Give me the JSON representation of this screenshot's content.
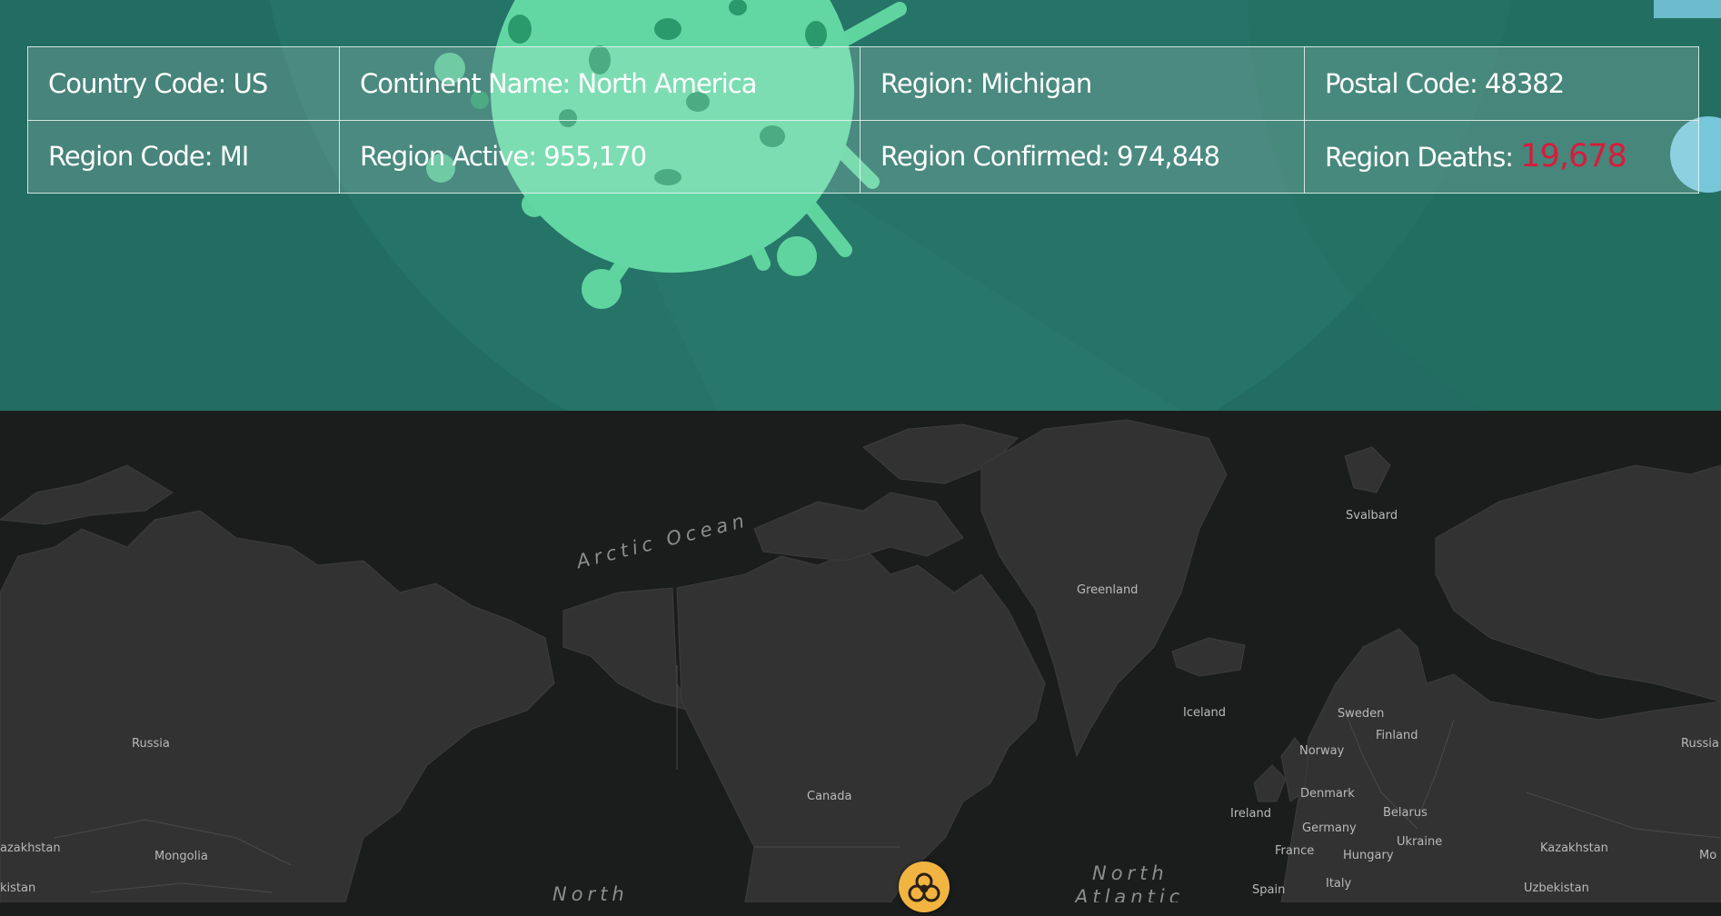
{
  "info": {
    "row1": {
      "country_code_label": "Country Code: ",
      "country_code": "US",
      "continent_label": "Continent Name: ",
      "continent": "North America",
      "region_label": "Region: ",
      "region": "Michigan",
      "postal_label": "Postal Code: ",
      "postal": "48382"
    },
    "row2": {
      "region_code_label": "Region Code: ",
      "region_code": "MI",
      "active_label": "Region Active: ",
      "active": "955,170",
      "confirmed_label": "Region Confirmed: ",
      "confirmed": "974,848",
      "deaths_label": "Region Deaths: ",
      "deaths": "19,678"
    }
  },
  "map": {
    "oceans": {
      "arctic": "Arctic Ocean",
      "north_pacific": "North",
      "north_atlantic_1": "North",
      "north_atlantic_2": "Atlantic"
    },
    "places": {
      "svalbard": "Svalbard",
      "greenland": "Greenland",
      "russia_left": "Russia",
      "russia_right": "Russia",
      "iceland": "Iceland",
      "sweden": "Sweden",
      "finland": "Finland",
      "norway": "Norway",
      "canada": "Canada",
      "denmark": "Denmark",
      "ireland": "Ireland",
      "belarus": "Belarus",
      "germany": "Germany",
      "ukraine": "Ukraine",
      "kazakhstan_left": "azakhstan",
      "kazakhstan_right": "Kazakhstan",
      "mongolia": "Mongolia",
      "france": "France",
      "hungary": "Hungary",
      "spain": "Spain",
      "italy": "Italy",
      "uzbekistan": "Uzbekistan",
      "kistan": "kistan",
      "mo": "Mo"
    },
    "marker_icon": "biohazard-icon"
  },
  "colors": {
    "hero_bg": "#226c61",
    "map_bg": "#1b1d1d",
    "land": "#333232",
    "deaths": "#d81b3c",
    "marker": "#f2b441",
    "virus": "#5fd49f"
  }
}
